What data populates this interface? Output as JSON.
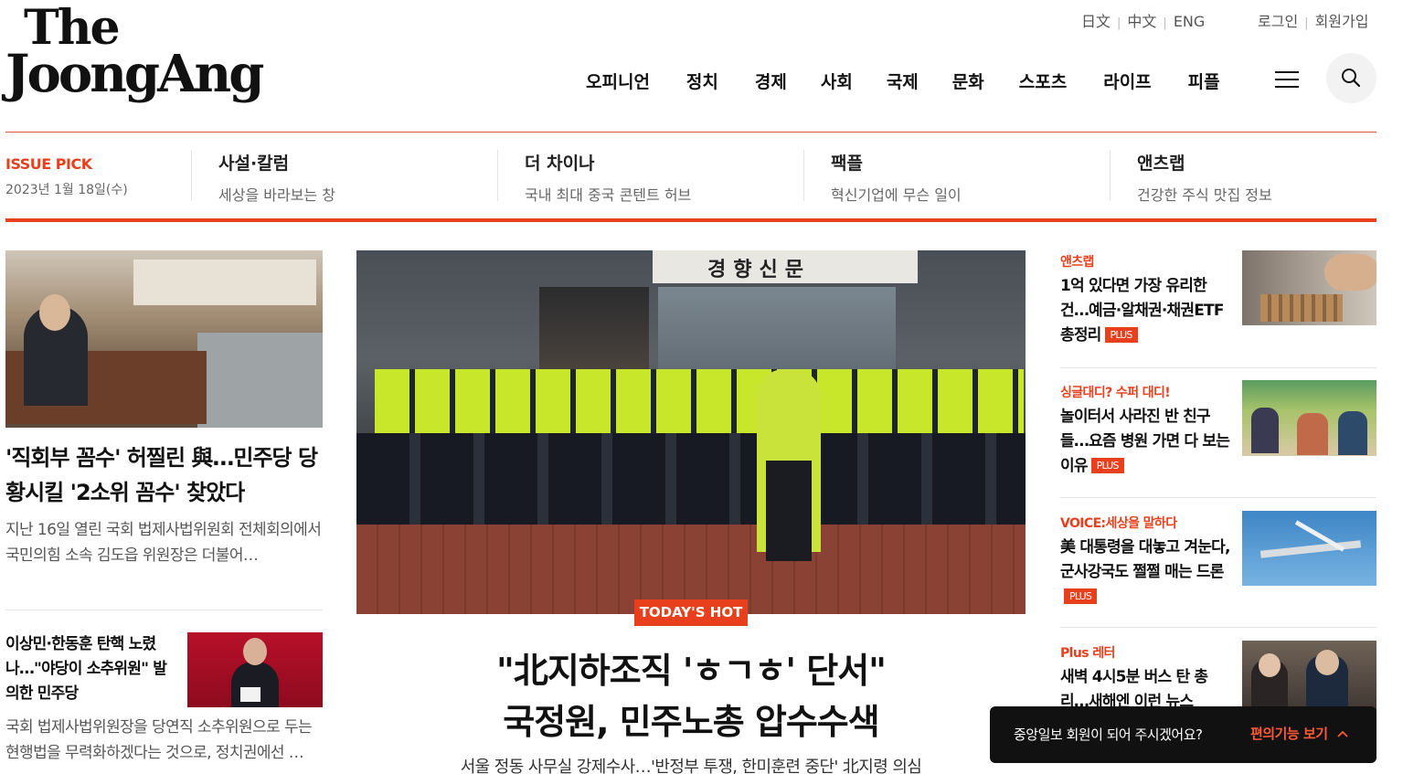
{
  "logo": {
    "line1": "The",
    "line2": "JoongAng"
  },
  "util_nav": {
    "languages": [
      "日文",
      "中文",
      "ENG"
    ],
    "login": "로그인",
    "signup": "회원가입"
  },
  "main_nav": [
    "오피니언",
    "정치",
    "경제",
    "사회",
    "국제",
    "문화",
    "스포츠",
    "라이프",
    "피플"
  ],
  "icons": {
    "menu": "hamburger-menu-icon",
    "search": "search-icon",
    "chevron": "chevron-up-icon"
  },
  "issue_pick": {
    "label": "ISSUE PICK",
    "date": "2023년 1월 18일(수)",
    "items": [
      {
        "title": "사설·칼럼",
        "sub": "세상을 바라보는 창"
      },
      {
        "title": "더 차이나",
        "sub": "국내 최대 중국 콘텐트 허브"
      },
      {
        "title": "팩플",
        "sub": "혁신기업에 무슨 일이"
      },
      {
        "title": "앤츠랩",
        "sub": "건강한 주식 맛집 정보"
      }
    ]
  },
  "left_col": {
    "story1": {
      "headline": "'직회부 꼼수' 허찔린 與…민주당 당황시킬 '2소위 꼼수' 찾았다",
      "summary": "지난 16일 열린 국회 법제사법위원회 전체회의에서 국민의힘 소속 김도읍 위원장은 더불어…"
    },
    "story2": {
      "headline": "이상민·한동훈 탄핵 노렸나…\"야당이 소추위원\" 발의한 민주당",
      "summary": "국회 법제사법위원장을 당연직 소추위원으로 두는 현행법을 무력화하겠다는 것으로, 정치권에선 …"
    }
  },
  "center": {
    "photo_sign": "경향신문",
    "badge": "TODAY'S HOT",
    "title_line1": "\"北지하조직 'ㅎㄱㅎ' 단서\"",
    "title_line2": "국정원, 민주노총 압수수색",
    "subtitle": "서울 정동 사무실 강제수사…'반정부 투쟁, 한미훈련 중단' 北지령 의심"
  },
  "right_col": [
    {
      "category": "앤츠랩",
      "title": "1억 있다면 가장 유리한 건…예금·알채권·채권ETF 총정리",
      "badge": "PLUS"
    },
    {
      "category": "싱글대디? 수퍼 대디!",
      "title": "놀이터서 사라진 반 친구들…요즘 병원 가면 다 보는 이유",
      "badge": "PLUS"
    },
    {
      "category": "VOICE:세상을 말하다",
      "title": "美 대통령을 대놓고 겨눈다, 군사강국도 쩔쩔 매는 드론",
      "badge": "PLUS"
    },
    {
      "category": "Plus 레터",
      "title": "새벽 4시5분 버스 탄 총리…새해엔 이런 뉴스",
      "badge": ""
    }
  ],
  "toast": {
    "message": "중앙일보 회원이 되어 주시겠어요?",
    "button": "편의기능 보기"
  },
  "colors": {
    "accent": "#e8401c",
    "text": "#111111",
    "muted": "#666666"
  }
}
